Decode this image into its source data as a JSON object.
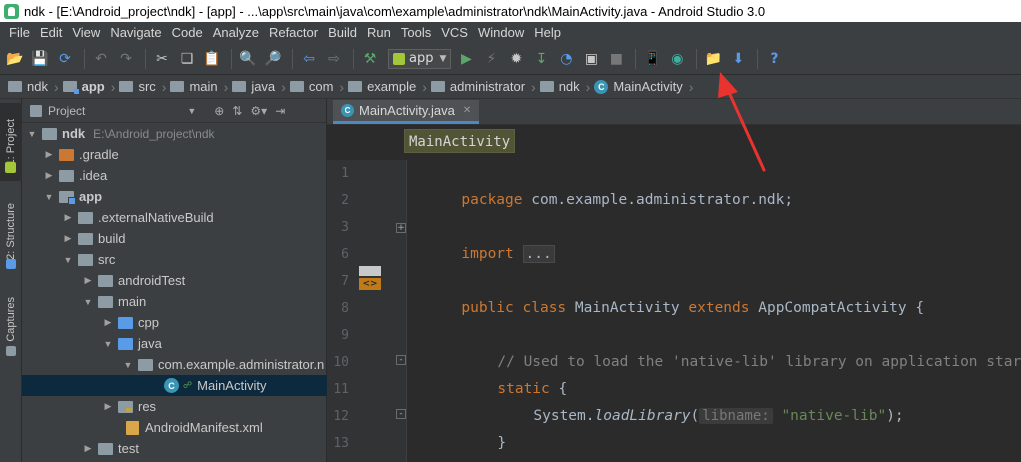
{
  "window": {
    "title": "ndk - [E:\\Android_project\\ndk] - [app] - ...\\app\\src\\main\\java\\com\\example\\administrator\\ndk\\MainActivity.java - Android Studio 3.0"
  },
  "menu": [
    "File",
    "Edit",
    "View",
    "Navigate",
    "Code",
    "Analyze",
    "Refactor",
    "Build",
    "Run",
    "Tools",
    "VCS",
    "Window",
    "Help"
  ],
  "toolbar": {
    "run_config": "app",
    "icons": [
      "open-icon",
      "save-icon",
      "sync-icon",
      "undo-icon",
      "redo-icon",
      "cut-icon",
      "copy-icon",
      "paste-icon",
      "find-icon",
      "replace-icon",
      "back-icon",
      "forward-icon",
      "make-icon",
      "run-icon",
      "apply-changes-icon",
      "debug-icon",
      "attach-debugger-icon",
      "profile-icon",
      "coverage-icon",
      "stop-icon",
      "avd-manager-icon",
      "sync-gradle-icon",
      "project-structure-icon",
      "sdk-manager-icon",
      "help-icon"
    ]
  },
  "breadcrumb": [
    "ndk",
    "app",
    "src",
    "main",
    "java",
    "com",
    "example",
    "administrator",
    "ndk",
    "MainActivity"
  ],
  "left_tools": {
    "project": "1: Project",
    "structure": "2: Structure",
    "captures": "Captures"
  },
  "project_panel": {
    "title": "Project",
    "tree": [
      {
        "label": "ndk",
        "path": "E:\\Android_project\\ndk"
      },
      {
        "label": ".gradle"
      },
      {
        "label": ".idea"
      },
      {
        "label": "app"
      },
      {
        "label": ".externalNativeBuild"
      },
      {
        "label": "build"
      },
      {
        "label": "src"
      },
      {
        "label": "androidTest"
      },
      {
        "label": "main"
      },
      {
        "label": "cpp"
      },
      {
        "label": "java"
      },
      {
        "label": "com.example.administrator.n"
      },
      {
        "label": "MainActivity"
      },
      {
        "label": "res"
      },
      {
        "label": "AndroidManifest.xml"
      },
      {
        "label": "test"
      }
    ]
  },
  "editor": {
    "tab": "MainActivity.java",
    "structure_hint": "MainActivity",
    "line_numbers": [
      "1",
      "2",
      "3",
      "6",
      "7",
      "8",
      "9",
      "10",
      "11",
      "12",
      "13"
    ],
    "code": {
      "l1_kw": "package",
      "l1_rest": " com.example.administrator.ndk;",
      "l3_kw": "import",
      "l3_collapsed": "...",
      "l7_kw1": "public",
      "l7_kw2": "class",
      "l7_name": " MainActivity ",
      "l7_kw3": "extends",
      "l7_rest": " AppCompatActivity {",
      "l9_comment": "// Used to load the 'native-lib' library on application startup.",
      "l10_kw": "static",
      "l10_rest": " {",
      "l11_obj": "System.",
      "l11_method": "loadLibrary",
      "l11_open": "(",
      "l11_hint": "libname:",
      "l11_str": "\"native-lib\"",
      "l11_close": ");",
      "l12": "}"
    }
  },
  "colors": {
    "keyword": "#cc7832",
    "comment": "#808080",
    "string": "#6a8759",
    "annotation_arrow": "#e8332e"
  }
}
